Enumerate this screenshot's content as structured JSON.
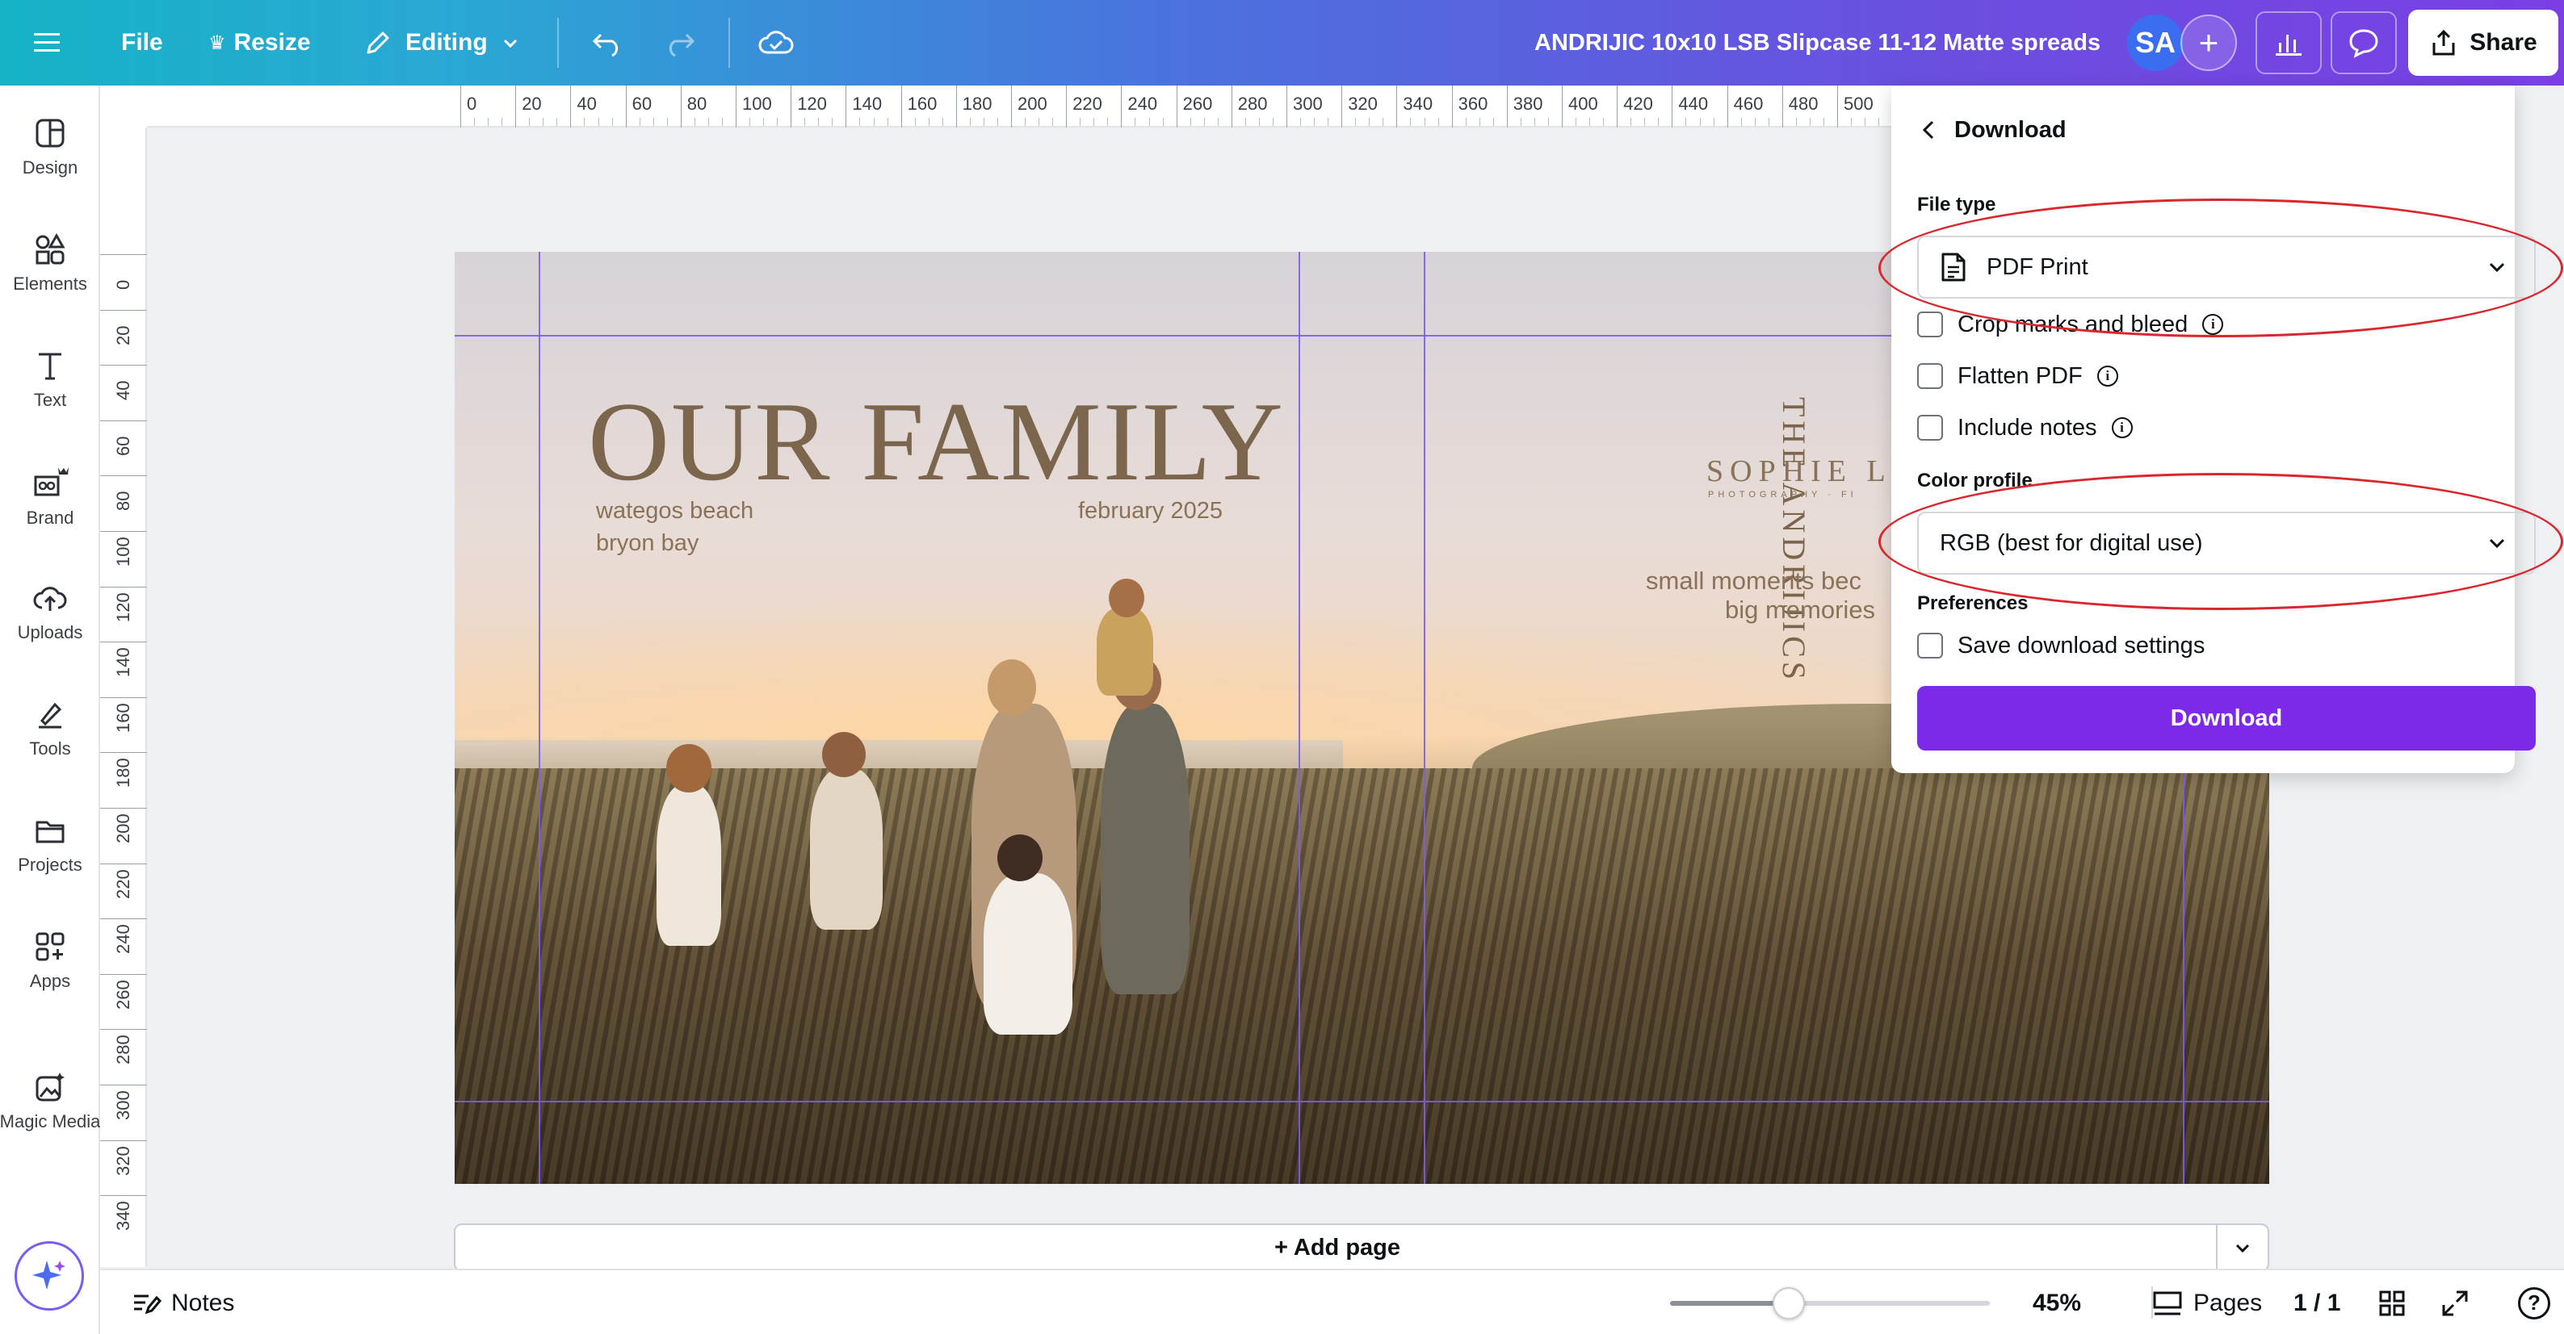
{
  "topbar": {
    "file": "File",
    "resize": "Resize",
    "editing": "Editing",
    "doc_title": "ANDRIJIC 10x10 LSB Slipcase 11-12 Matte spreads",
    "avatar_initials": "SA",
    "share": "Share"
  },
  "sidebar": {
    "items": [
      {
        "label": "Design",
        "icon": "design-icon"
      },
      {
        "label": "Elements",
        "icon": "elements-icon"
      },
      {
        "label": "Text",
        "icon": "text-icon"
      },
      {
        "label": "Brand",
        "icon": "brand-icon"
      },
      {
        "label": "Uploads",
        "icon": "uploads-icon"
      },
      {
        "label": "Tools",
        "icon": "tools-icon"
      },
      {
        "label": "Projects",
        "icon": "projects-icon"
      },
      {
        "label": "Apps",
        "icon": "apps-icon"
      },
      {
        "label": "Magic Media",
        "icon": "magic-media-icon"
      }
    ]
  },
  "rulers": {
    "top": [
      "0",
      "20",
      "40",
      "60",
      "80",
      "100",
      "120",
      "140",
      "160",
      "180",
      "200",
      "220",
      "240",
      "260",
      "280",
      "300",
      "320",
      "340",
      "360",
      "380",
      "400",
      "420",
      "440",
      "460",
      "480",
      "500"
    ],
    "left": [
      "0",
      "20",
      "40",
      "60",
      "80",
      "100",
      "120",
      "140",
      "160",
      "180",
      "200",
      "220",
      "240",
      "260",
      "280",
      "300",
      "320",
      "340"
    ]
  },
  "design": {
    "title": "OUR FAMILY",
    "location_line1": "wategos beach",
    "location_line2": "bryon bay",
    "date": "february 2025",
    "spine": "THE ANDRIJICS",
    "brand_name": "SOPHIE LEA",
    "brand_sub": "PHOTOGRAPHY · FI",
    "tagline_line1": "small  moments bec",
    "tagline_line2": "big memories"
  },
  "add_page": "+ Add page",
  "bottombar": {
    "notes": "Notes",
    "zoom": "45%",
    "zoom_fraction": 0.37,
    "pages": "Pages",
    "page_count": "1 / 1",
    "help": "?"
  },
  "download_panel": {
    "title": "Download",
    "file_type_label": "File type",
    "file_type_value": "PDF Print",
    "options": [
      "Crop marks and bleed",
      "Flatten PDF",
      "Include notes"
    ],
    "color_profile_label": "Color profile",
    "color_profile_value": "RGB (best for digital use)",
    "preferences_label": "Preferences",
    "save_settings": "Save download settings",
    "download_button": "Download"
  },
  "colors": {
    "accent": "#7d2ae8",
    "guide": "#7b5cf0",
    "annotation": "#d9272e"
  }
}
